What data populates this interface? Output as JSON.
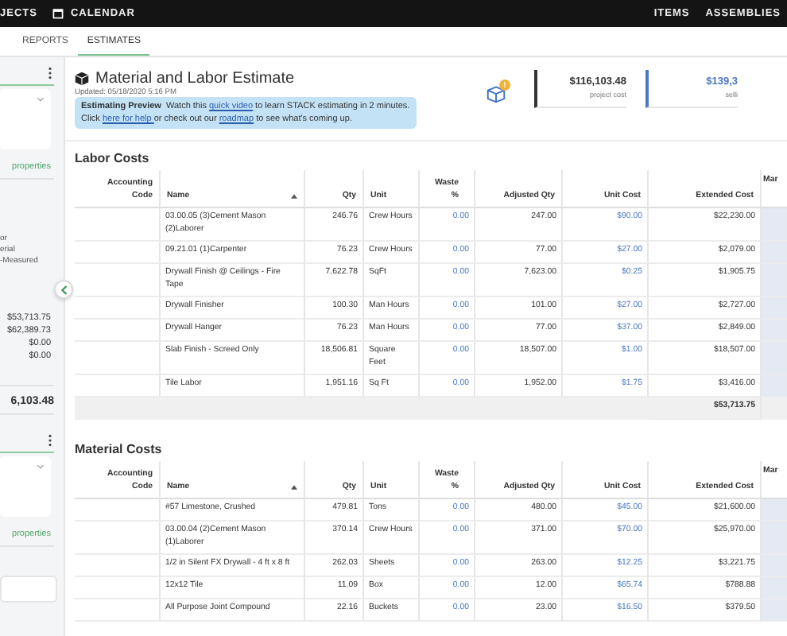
{
  "nav": {
    "left_items": [
      {
        "label": "JECTS"
      },
      {
        "label": "CALENDAR"
      }
    ],
    "right_items": [
      "ITEMS",
      "ASSEMBLIES"
    ]
  },
  "tabs": [
    {
      "label": "REPORTS",
      "selected": false
    },
    {
      "label": "ESTIMATES",
      "selected": true
    }
  ],
  "sidebar": {
    "panels": [
      {
        "link": "properties",
        "labels": [
          "or",
          "erial",
          "-Measured"
        ],
        "amounts": [
          "$53,713.75",
          "$62,389.73",
          "$0.00",
          "$0.00"
        ],
        "total": "6,103.48"
      },
      {
        "link": "properties"
      }
    ]
  },
  "estimate": {
    "title": "Material and Labor Estimate",
    "updated": "Updated: 05/18/2020 5:16 PM",
    "banner": [
      [
        {
          "kind": "bold",
          "text": "Estimating Preview"
        },
        {
          "kind": "text",
          "text": "  Watch this "
        },
        {
          "kind": "link",
          "text": "quick video"
        },
        {
          "kind": "text",
          "text": " to learn STACK estimating in 2 minutes."
        }
      ],
      [
        {
          "kind": "text",
          "text": "Click "
        },
        {
          "kind": "link",
          "text": "here for help "
        },
        {
          "kind": "text",
          "text": "or check out our "
        },
        {
          "kind": "link",
          "text": "roadmap"
        },
        {
          "kind": "text",
          "text": " to see what's coming up."
        }
      ]
    ],
    "badge": "!",
    "stats": [
      {
        "value": "$116,103.48",
        "label": "project cost",
        "color": "#333333"
      },
      {
        "value": "$139,3",
        "label": "selli",
        "color": "#4a78c2"
      }
    ]
  },
  "sections": [
    {
      "title": "Labor Costs",
      "columns": [
        {
          "label": "Accounting Code",
          "kind": "code",
          "sorted": false
        },
        {
          "label": "Name",
          "kind": "name",
          "sorted": true
        },
        {
          "label": "Qty",
          "kind": "qty",
          "sorted": false
        },
        {
          "label": "Unit",
          "kind": "unit",
          "sorted": false
        },
        {
          "label": "Waste %",
          "kind": "waste",
          "sorted": false
        },
        {
          "label": "Adjusted Qty",
          "kind": "adjusted",
          "sorted": false
        },
        {
          "label": "Unit Cost",
          "kind": "unit_cost",
          "sorted": false
        },
        {
          "label": "Extended Cost",
          "kind": "extended",
          "sorted": false
        },
        {
          "label": "Mar",
          "kind": "shaded",
          "sorted": false
        }
      ],
      "rows": [
        {
          "name": "03.00.05 (3)Cement Mason (2)Laborer",
          "qty": "246.76",
          "unit": "Crew Hours",
          "waste": "0.00",
          "adjusted": "247.00",
          "unit_cost": "$90.00",
          "extended": "$22,230.00"
        },
        {
          "name": "09.21.01 (1)Carpenter",
          "qty": "76.23",
          "unit": "Crew Hours",
          "waste": "0.00",
          "adjusted": "77.00",
          "unit_cost": "$27.00",
          "extended": "$2,079.00"
        },
        {
          "name": "Drywall Finish @ Ceilings - Fire Tape",
          "qty": "7,622.78",
          "unit": "SqFt",
          "waste": "0.00",
          "adjusted": "7,623.00",
          "unit_cost": "$0.25",
          "extended": "$1,905.75"
        },
        {
          "name": "Drywall Finisher",
          "qty": "100.30",
          "unit": "Man Hours",
          "waste": "0.00",
          "adjusted": "101.00",
          "unit_cost": "$27.00",
          "extended": "$2,727.00"
        },
        {
          "name": "Drywall Hanger",
          "qty": "76.23",
          "unit": "Man Hours",
          "waste": "0.00",
          "adjusted": "77.00",
          "unit_cost": "$37.00",
          "extended": "$2,849.00"
        },
        {
          "name": "Slab Finish - Screed Only",
          "qty": "18,506.81",
          "unit": "Square Feet",
          "waste": "0.00",
          "adjusted": "18,507.00",
          "unit_cost": "$1.00",
          "extended": "$18,507.00"
        },
        {
          "name": "Tile Labor",
          "qty": "1,951.16",
          "unit": "Sq Ft",
          "waste": "0.00",
          "adjusted": "1,952.00",
          "unit_cost": "$1.75",
          "extended": "$3,416.00"
        }
      ],
      "total": {
        "extended": "$53,713.75"
      }
    },
    {
      "title": "Material Costs",
      "columns": [
        {
          "label": "Accounting Code",
          "kind": "code",
          "sorted": false
        },
        {
          "label": "Name",
          "kind": "name",
          "sorted": true
        },
        {
          "label": "Qty",
          "kind": "qty",
          "sorted": false
        },
        {
          "label": "Unit",
          "kind": "unit",
          "sorted": false
        },
        {
          "label": "Waste %",
          "kind": "waste",
          "sorted": false
        },
        {
          "label": "Adjusted Qty",
          "kind": "adjusted",
          "sorted": false
        },
        {
          "label": "Unit Cost",
          "kind": "unit_cost",
          "sorted": false
        },
        {
          "label": "Extended Cost",
          "kind": "extended",
          "sorted": false
        },
        {
          "label": "Mar",
          "kind": "shaded",
          "sorted": false
        }
      ],
      "rows": [
        {
          "name": "#57 Limestone, Crushed",
          "qty": "479.81",
          "unit": "Tons",
          "waste": "0.00",
          "adjusted": "480.00",
          "unit_cost": "$45.00",
          "extended": "$21,600.00"
        },
        {
          "name": "03.00.04 (2)Cement Mason (1)Laborer",
          "qty": "370.14",
          "unit": "Crew Hours",
          "waste": "0.00",
          "adjusted": "371.00",
          "unit_cost": "$70.00",
          "extended": "$25,970.00"
        },
        {
          "name": "1/2 in Silent FX Drywall - 4 ft x 8 ft",
          "qty": "262.03",
          "unit": "Sheets",
          "waste": "0.00",
          "adjusted": "263.00",
          "unit_cost": "$12.25",
          "extended": "$3,221.75"
        },
        {
          "name": "12x12 Tile",
          "qty": "11.09",
          "unit": "Box",
          "waste": "0.00",
          "adjusted": "12.00",
          "unit_cost": "$65.74",
          "extended": "$788.88"
        },
        {
          "name": "All Purpose Joint Compound",
          "qty": "22.16",
          "unit": "Buckets",
          "waste": "0.00",
          "adjusted": "23.00",
          "unit_cost": "$16.50",
          "extended": "$379.50"
        }
      ]
    }
  ]
}
